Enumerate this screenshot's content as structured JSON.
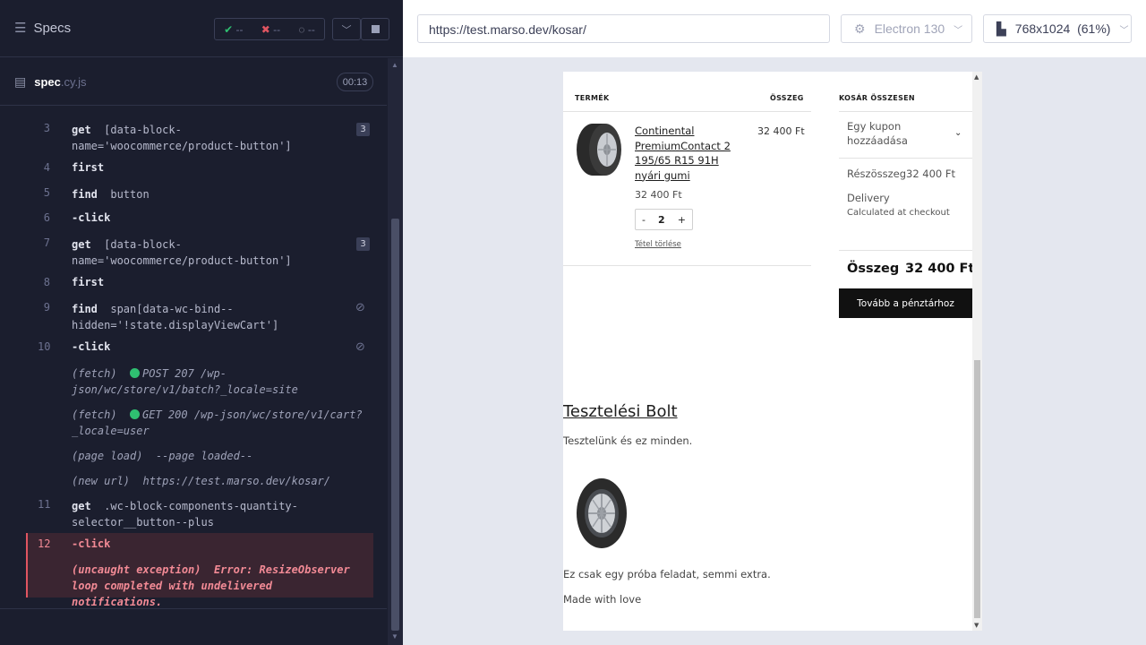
{
  "runner": {
    "specs_label": "Specs",
    "stats": {
      "passed": "--",
      "failed": "--",
      "pending": "--"
    },
    "spec_file": {
      "name": "spec",
      "ext": ".cy.js",
      "duration": "00:13"
    },
    "commands": [
      {
        "num": "3",
        "name": "get",
        "text": "[data-block-name='woocommerce/product-button']",
        "badge": "3"
      },
      {
        "num": "4",
        "name": "first"
      },
      {
        "num": "5",
        "name": "find",
        "text": "button"
      },
      {
        "num": "6",
        "name": "-click"
      },
      {
        "num": "7",
        "name": "get",
        "text": "[data-block-name='woocommerce/product-button']",
        "badge": "3"
      },
      {
        "num": "8",
        "name": "first"
      },
      {
        "num": "9",
        "name": "find",
        "text": "span[data-wc-bind--hidden='!state.displayViewCart']"
      },
      {
        "num": "10",
        "name": "-click"
      },
      {
        "num": "11",
        "name": "get",
        "text": ".wc-block-components-quantity-selector__button--plus"
      },
      {
        "num": "12",
        "name": "-click"
      }
    ],
    "logs": {
      "fetch1_type": "(fetch)",
      "fetch1_text": "POST 207 /wp-json/wc/store/v1/batch?_locale=site",
      "fetch2_type": "(fetch)",
      "fetch2_text": "GET 200 /wp-json/wc/store/v1/cart?_locale=user",
      "page_load_type": "(page load)",
      "page_load_text": "--page loaded--",
      "new_url_type": "(new url)",
      "new_url_text": "https://test.marso.dev/kosar/",
      "error_type": "(uncaught exception)",
      "error_text": "Error: ResizeObserver loop completed with undelivered notifications."
    }
  },
  "browser": {
    "url": "https://test.marso.dev/kosar/",
    "engine": "Electron 130",
    "viewport": "768x1024",
    "zoom": "(61%)"
  },
  "cart": {
    "col_product": "TERMÉK",
    "col_total": "ÖSSZEG",
    "col_cart_totals": "KOSÁR ÖSSZESEN",
    "product_name": "Continental PremiumContact 2 195/65 R15 91H nyári gumi",
    "product_price": "32 400 Ft",
    "quantity": "2",
    "qty_minus": "-",
    "qty_plus": "+",
    "remove_item": "Tétel törlése",
    "line_total": "32 400 Ft",
    "coupon": "Egy kupon hozzáadása",
    "subtotal_label": "Részösszeg",
    "subtotal_value": "32 400 Ft",
    "delivery_label": "Delivery",
    "delivery_note": "Calculated at checkout",
    "total_label": "Összeg",
    "total_value": "32 400 Ft",
    "checkout_button": "Tovább a pénztárhoz"
  },
  "footer": {
    "site_title": "Tesztelési Bolt",
    "tagline": "Tesztelünk és ez minden.",
    "text1": "Ez csak egy próba feladat, semmi extra.",
    "text2": "Made with love"
  }
}
